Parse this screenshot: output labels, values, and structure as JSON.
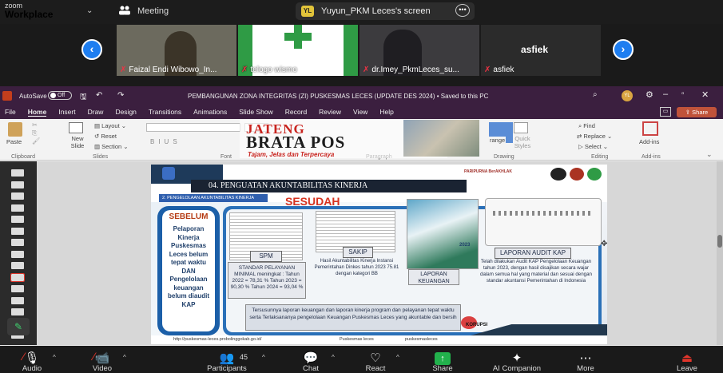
{
  "zoom": {
    "logo_small": "zoom",
    "logo_main": "Workplace",
    "meeting_label": "Meeting",
    "screen_initials": "YL",
    "screen_label": "Yuyun_PKM Leces's screen"
  },
  "participants": [
    {
      "name": "Faizal Endi Wibowo_In..."
    },
    {
      "name": "telogo wismo"
    },
    {
      "name": "dr.Imey_PkmLeces_su..."
    },
    {
      "name": "asfiek",
      "header": "asfiek"
    }
  ],
  "ppt": {
    "autosave": "AutoSave",
    "autosave_state": "Off",
    "doc_title": "PEMBANGUNAN ZONA INTEGRITAS (ZI) PUSKESMAS LECES (UPDATE DES 2024) • Saved to this PC",
    "user_initials": "YL",
    "menu": [
      "File",
      "Home",
      "Insert",
      "Draw",
      "Design",
      "Transitions",
      "Animations",
      "Slide Show",
      "Record",
      "Review",
      "View",
      "Help"
    ],
    "share": "Share",
    "ribbon": {
      "paste": "Paste",
      "new_slide": "New Slide",
      "layout": "Layout",
      "reset": "Reset",
      "section": "Section",
      "find": "Find",
      "replace": "Replace",
      "select": "Select",
      "addins": "Add-ins",
      "arrange": "range",
      "quick_styles": "Quick Styles",
      "groups": [
        "Clipboard",
        "Slides",
        "Font",
        "Paragraph",
        "Drawing",
        "Editing",
        "Add-ins"
      ]
    }
  },
  "watermark": {
    "line1": "JATENG",
    "line2": "BRATA POS",
    "tagline": "Tajam, Jelas dan Terpercaya"
  },
  "slide": {
    "heading": "04. PENGUATAN AKUNTABILITAS KINERJA",
    "subheading": "2. PENGELOLAAN AKUNTABILITAS KINERJA",
    "sesudah": "SESUDAH",
    "sebelum_title": "SEBELUM",
    "sebelum_text": "Pelaporan Kinerja Puskesmas Leces belum tepat waktu DAN Pengelolaan keuangan belum diaudit KAP",
    "spm_label": "SPM",
    "spm_text": "STANDAR PELAYANAN MINIMAL meningkat : Tahun 2022 = 78,31 % Tahun 2023 = 90,30 % Tahun 2024 = 93,04 %",
    "sakip_label": "SAKIP",
    "sakip_text": "Hasil Akuntabilitas Kinerja Instansi Pemerintahan Dinkes tahun 2023 75.81 dengan kategori BB",
    "laporan_year": "2023",
    "laporan_label": "LAPORAN KEUANGAN",
    "audit_label": "LAPORAN AUDIT KAP",
    "audit_text": "Telah dilakukan Audit KAP Pengelolaan Keuangan tahun 2023, dengan hasil disajikan secara wajar dalam semua hal yang material dan sesuai dengan standar akuntansi Pemerintahan di Indonesia",
    "bottom_text": "Tersusunnya laporan keuangan dan laporan kinerja program dan pelayanan tepat waktu serta Terlaksananya pengelolaan Keuangan Puskesmas Leces yang akuntable dan bersih",
    "footer_url": "http://puskesmas-leces.probolinggokab.go.id/",
    "footer_social1": "Puskesmas leces",
    "footer_social2": "puskesmasleces",
    "stamp": "KORUPSI",
    "logos_text": "PARIPURNA  BerAKHLAK"
  },
  "controls": [
    {
      "label": "Audio",
      "icon": "mic-off-icon"
    },
    {
      "label": "Video",
      "icon": "video-off-icon"
    },
    {
      "label": "Participants",
      "icon": "participants-icon",
      "count": "45"
    },
    {
      "label": "Chat",
      "icon": "chat-icon"
    },
    {
      "label": "React",
      "icon": "react-icon"
    },
    {
      "label": "Share",
      "icon": "share-icon"
    },
    {
      "label": "AI Companion",
      "icon": "ai-companion-icon"
    },
    {
      "label": "More",
      "icon": "more-icon"
    },
    {
      "label": "Leave",
      "icon": "leave-icon"
    }
  ],
  "colors": {
    "zoom_blue": "#1e7ef0",
    "ppt_purple": "#3b1f3f",
    "share_green": "#22b14c",
    "leave_red": "#e0352b"
  }
}
